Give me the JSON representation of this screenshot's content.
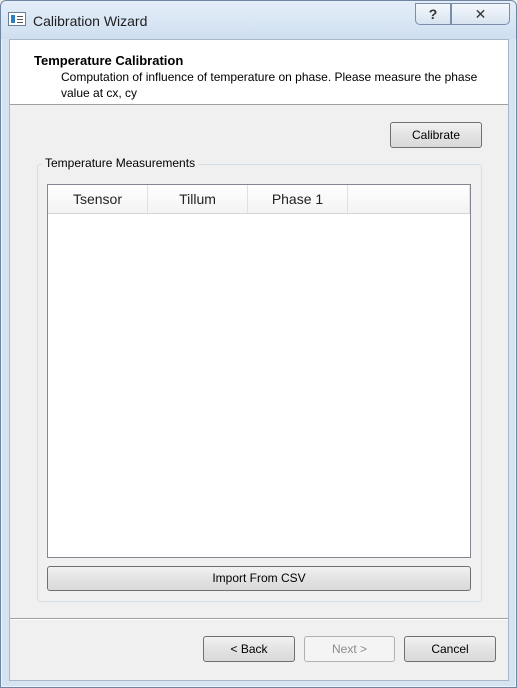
{
  "window": {
    "title": "Calibration Wizard",
    "help_glyph": "?",
    "close_glyph": "✕"
  },
  "page": {
    "title": "Temperature Calibration",
    "subtitle": "Computation of influence of temperature on phase. Please measure the phase value at cx, cy"
  },
  "buttons": {
    "calibrate": "Calibrate",
    "import_csv": "Import From CSV",
    "back": "< Back",
    "next": "Next >",
    "cancel": "Cancel"
  },
  "measurements": {
    "group_title": "Temperature Measurements",
    "columns": [
      "Tsensor",
      "Tillum",
      "Phase 1"
    ],
    "rows": []
  },
  "icons": {
    "app": "wizard-window-icon",
    "help": "help-icon",
    "close": "close-icon"
  }
}
